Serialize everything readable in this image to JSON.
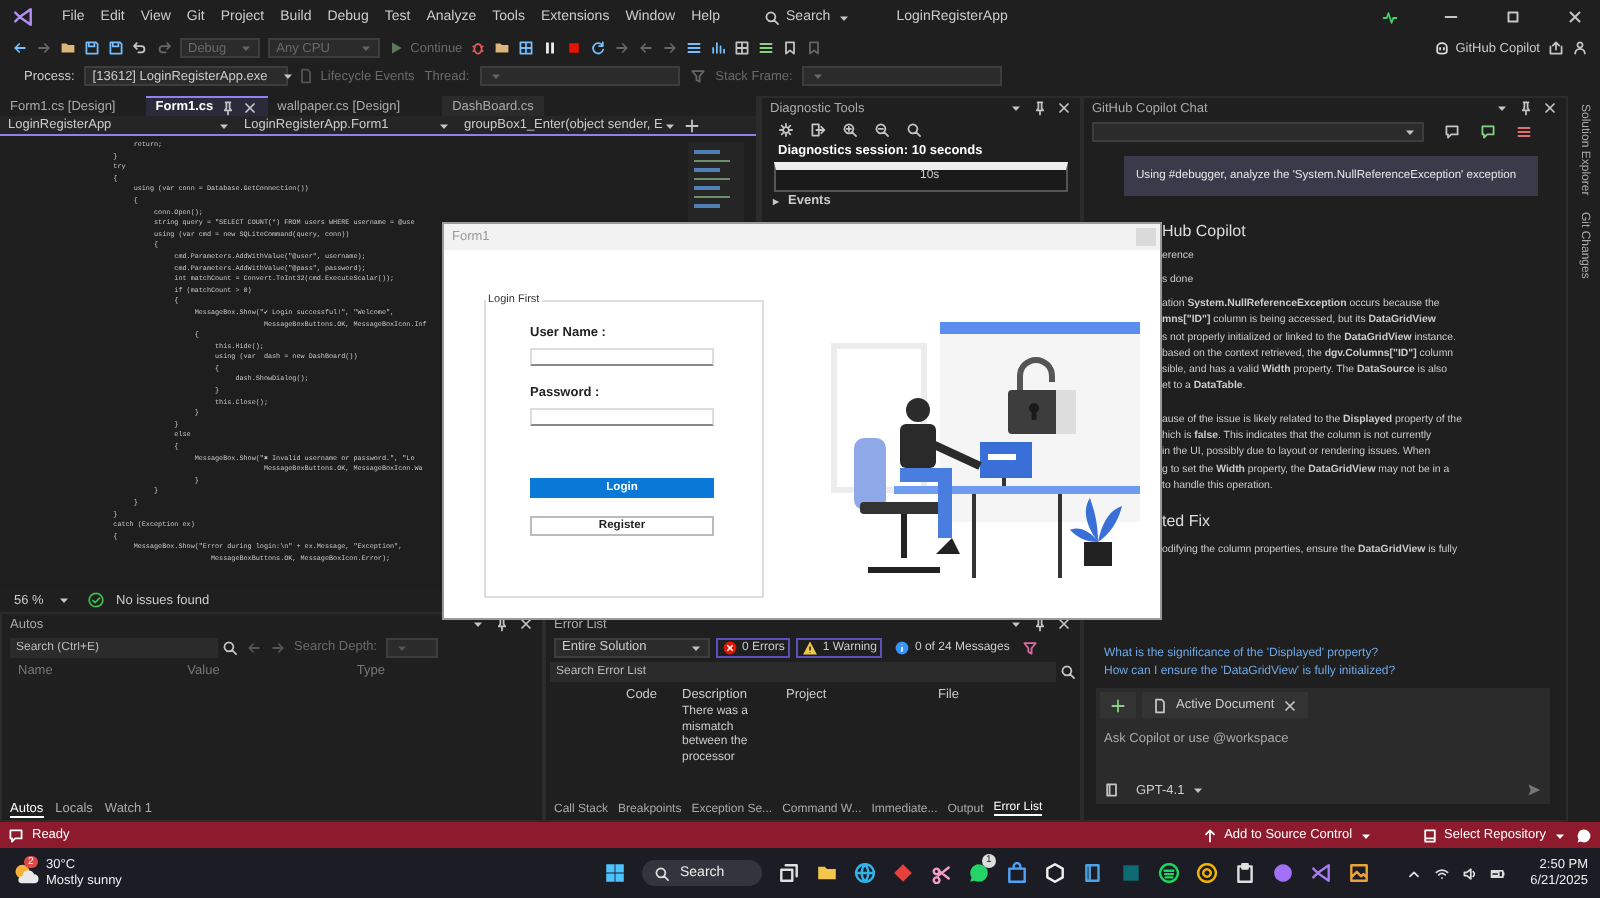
{
  "menu_bar": {
    "items": [
      "File",
      "Edit",
      "View",
      "Git",
      "Project",
      "Build",
      "Debug",
      "Test",
      "Analyze",
      "Tools",
      "Extensions",
      "Window",
      "Help"
    ],
    "search": "Search",
    "solution_name": "LoginRegisterApp"
  },
  "toolbar": {
    "configuration": "Debug",
    "platform": "Any CPU",
    "continue": "Continue",
    "copilot": "GitHub Copilot"
  },
  "process_bar": {
    "process_label": "Process:",
    "process": "[13612] LoginRegisterApp.exe",
    "lifecycle": "Lifecycle Events",
    "thread_label": "Thread:",
    "stack_frame_label": "Stack Frame:"
  },
  "document_tabs": [
    {
      "label": "Form1.cs [Design]",
      "selected": false
    },
    {
      "label": "Form1.cs",
      "selected": true
    },
    {
      "label": "wallpaper.cs [Design]",
      "selected": false
    },
    {
      "label": "DashBoard.cs",
      "selected": false
    }
  ],
  "navigation_bar": [
    "LoginRegisterApp",
    "LoginRegisterApp.Form1",
    "groupBox1_Enter(object sender, E"
  ],
  "code_lines": [
    "                        return;",
    "                   }",
    "                   try",
    "                   {",
    "                        using (var conn = Database.GetConnection())",
    "                        {",
    "                             conn.Open();",
    "                             string query = \"SELECT COUNT(*) FROM users WHERE username = @use",
    "                             using (var cmd = new SQLiteCommand(query, conn))",
    "                             {",
    "                                  cmd.Parameters.AddWithValue(\"@user\", username);",
    "                                  cmd.Parameters.AddWithValue(\"@pass\", password);",
    "                                  int matchCount = Convert.ToInt32(cmd.ExecuteScalar());",
    "                                  if (matchCount > 0)",
    "                                  {",
    "                                       MessageBox.Show(\"✔ Login successful!\", \"Welcome\",",
    "                                                        MessageBoxButtons.OK, MessageBoxIcon.Inf",
    "                                       {",
    "                                            this.Hide();",
    "                                            using (var  dash = new DashBoard())",
    "                                            {",
    "                                                 dash.ShowDialog();",
    "                                            }",
    "                                            this.Close();",
    "                                       }",
    "                                  }",
    "                                  else",
    "                                  {",
    "                                       MessageBox.Show(\"✖ Invalid username or password.\", \"Lo",
    "                                                        MessageBoxButtons.OK, MessageBoxIcon.Wa",
    "                                       }",
    "                             }",
    "                        }",
    "                   }",
    "                   catch (Exception ex)",
    "                   {",
    "                        MessageBox.Show(\"Error during login:\\n\" + ex.Message, \"Exception\",",
    "                                           MessageBoxButtons.OK, MessageBoxIcon.Error);"
  ],
  "editor_status": {
    "zoom": "56 %",
    "issues": "No issues found"
  },
  "diagnostic_tools": {
    "title": "Diagnostic Tools",
    "session": "Diagnostics session: 10 seconds",
    "timeline_tick": "10s",
    "events": "Events"
  },
  "form_window": {
    "title": "Form1",
    "group_title": "Login First",
    "fields": [
      {
        "label": "User Name :"
      },
      {
        "label": "Password :"
      }
    ],
    "buttons": [
      {
        "label": "Login",
        "kind": "primary"
      },
      {
        "label": "Register",
        "kind": "secondary"
      }
    ]
  },
  "copilot_chat": {
    "title": "GitHub Copilot Chat",
    "user_message": "Using #debugger, analyze the 'System.NullReferenceException' exception",
    "response": [
      {
        "kind": "heading",
        "text": "Hub Copilot"
      },
      {
        "kind": "step",
        "text": "erence"
      },
      {
        "kind": "step",
        "text": "s done"
      },
      {
        "kind": "paragraph",
        "lines": [
          "ation **System.NullReferenceException** occurs because the",
          "**mns[\"ID\"]** column is being accessed, but its **DataGridView**",
          "s not properly initialized or linked to the **DataGridView** instance.",
          "based on the context retrieved, the **dgv.Columns[\"ID\"]** column",
          "sible, and has a valid **Width** property. The **DataSource** is also",
          "et to a **DataTable**."
        ]
      },
      {
        "kind": "paragraph",
        "lines": [
          "ause of the issue is likely related to the **Displayed** property of the",
          "hich is **false**. This indicates that the column is not currently",
          "in the UI, possibly due to layout or rendering issues. When",
          "g to set the **Width** property, the **DataGridView** may not be in a",
          "to handle this operation."
        ]
      },
      {
        "kind": "heading",
        "text": "ted Fix"
      },
      {
        "kind": "paragraph",
        "lines": [
          "odifying the column properties, ensure the **DataGridView** is fully"
        ]
      }
    ],
    "suggestions": [
      "What is the significance of the 'Displayed' property?",
      "How can I ensure the 'DataGridView' is fully initialized?"
    ],
    "context_chip": "Active Document",
    "input_placeholder": "Ask Copilot or use @workspace",
    "model": "GPT-4.1"
  },
  "side_tabs": [
    "Solution Explorer",
    "Git Changes"
  ],
  "autos": {
    "title": "Autos",
    "search_placeholder": "Search (Ctrl+E)",
    "search_depth": "Search Depth:",
    "columns": [
      "Name",
      "Value",
      "Type"
    ],
    "tabs": [
      {
        "label": "Autos",
        "selected": true
      },
      {
        "label": "Locals",
        "selected": false
      },
      {
        "label": "Watch 1",
        "selected": false
      }
    ]
  },
  "error_list": {
    "title": "Error List",
    "scope": "Entire Solution",
    "errors": "0 Errors",
    "warnings": "1 Warning",
    "messages": "0 of 24 Messages",
    "search_placeholder": "Search Error List",
    "columns": [
      "Code",
      "Description",
      "Project",
      "File"
    ],
    "rows": [
      {
        "description": "There was a mismatch between the processor"
      }
    ],
    "tabs": [
      {
        "label": "Call Stack",
        "selected": false
      },
      {
        "label": "Breakpoints",
        "selected": false
      },
      {
        "label": "Exception Se...",
        "selected": false
      },
      {
        "label": "Command W...",
        "selected": false
      },
      {
        "label": "Immediate...",
        "selected": false
      },
      {
        "label": "Output",
        "selected": false
      },
      {
        "label": "Error List",
        "selected": true
      }
    ]
  },
  "status_bar": {
    "status": "Ready",
    "source_control": "Add to Source Control",
    "repository": "Select Repository"
  },
  "taskbar": {
    "weather_badge": "2",
    "temperature": "30°C",
    "condition": "Mostly sunny",
    "search": "Search",
    "chat_badge": "1",
    "time": "2:50 PM",
    "date": "6/21/2025"
  }
}
